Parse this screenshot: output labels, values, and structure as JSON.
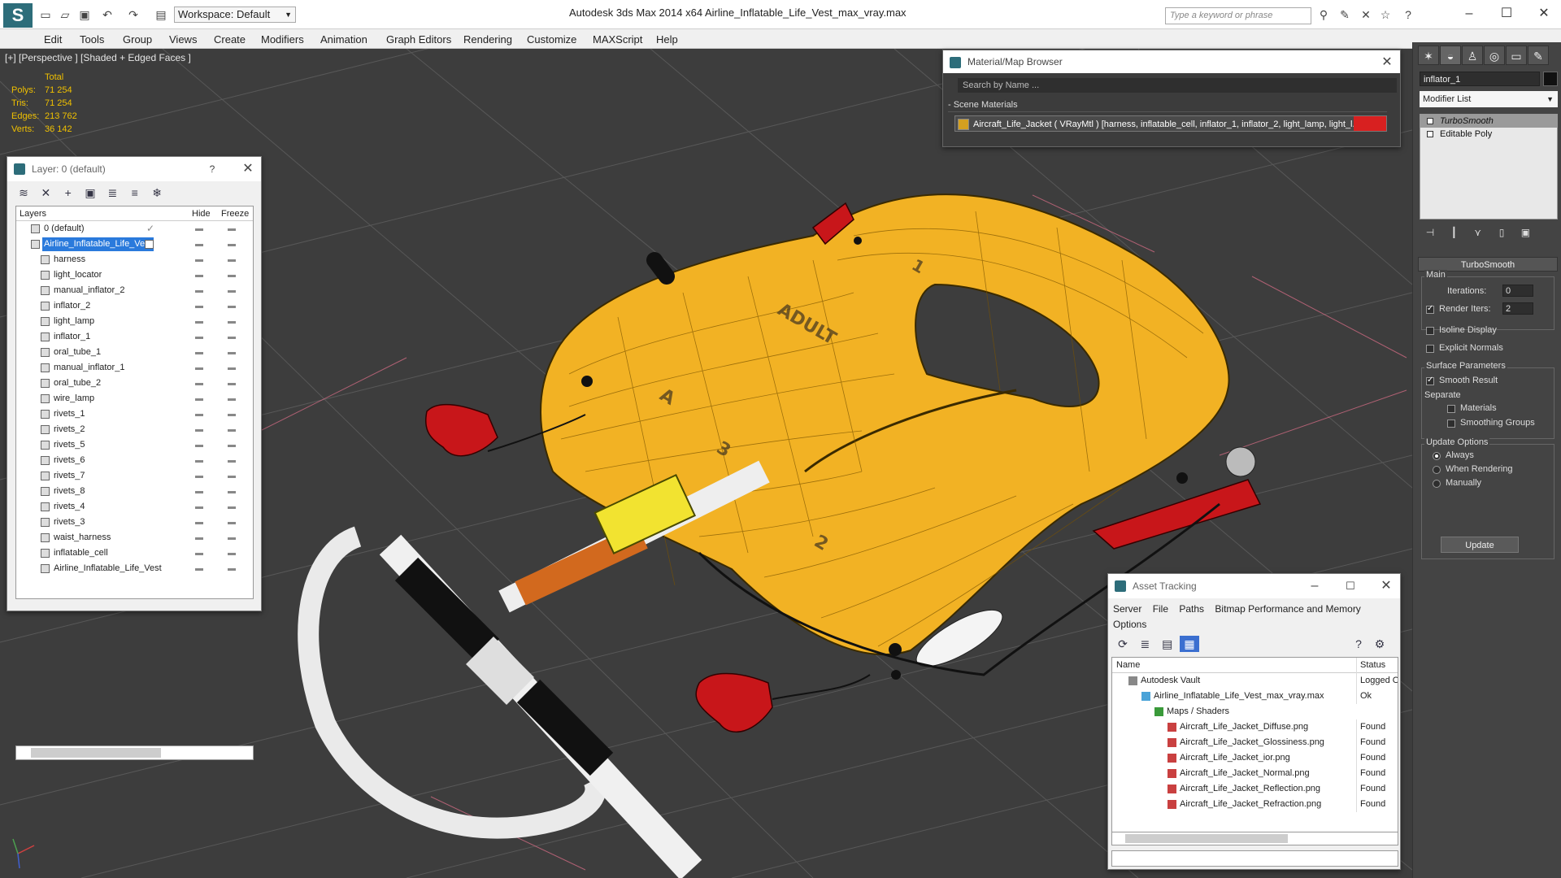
{
  "app": {
    "window_title": "Autodesk 3ds Max  2014 x64      Airline_Inflatable_Life_Vest_max_vray.max",
    "workspace": "Workspace: Default",
    "search_placeholder": "Type a keyword or phrase"
  },
  "menu": [
    "Edit",
    "Tools",
    "Group",
    "Views",
    "Create",
    "Modifiers",
    "Animation",
    "Graph Editors",
    "Rendering",
    "Customize",
    "MAXScript",
    "Help"
  ],
  "viewport": {
    "label": "[+] [Perspective ] [Shaded + Edged Faces ]",
    "stats": {
      "header": "Total",
      "rows": [
        {
          "label": "Polys:",
          "value": "71 254"
        },
        {
          "label": "Tris:",
          "value": "71 254"
        },
        {
          "label": "Edges:",
          "value": "213 762"
        },
        {
          "label": "Verts:",
          "value": "36 142"
        }
      ]
    }
  },
  "layer_dialog": {
    "title": "Layer: 0 (default)",
    "help": "?",
    "columns": {
      "layers": "Layers",
      "hide": "Hide",
      "freeze": "Freeze"
    },
    "rows": [
      {
        "name": "0 (default)",
        "level": 1,
        "type": "layer"
      },
      {
        "name": "Airline_Inflatable_Life_Vest",
        "level": 1,
        "type": "layer",
        "selected": true
      },
      {
        "name": "harness",
        "level": 2,
        "type": "object"
      },
      {
        "name": "light_locator",
        "level": 2,
        "type": "object"
      },
      {
        "name": "manual_inflator_2",
        "level": 2,
        "type": "object"
      },
      {
        "name": "inflator_2",
        "level": 2,
        "type": "object"
      },
      {
        "name": "light_lamp",
        "level": 2,
        "type": "object"
      },
      {
        "name": "inflator_1",
        "level": 2,
        "type": "object"
      },
      {
        "name": "oral_tube_1",
        "level": 2,
        "type": "object"
      },
      {
        "name": "manual_inflator_1",
        "level": 2,
        "type": "object"
      },
      {
        "name": "oral_tube_2",
        "level": 2,
        "type": "object"
      },
      {
        "name": "wire_lamp",
        "level": 2,
        "type": "object"
      },
      {
        "name": "rivets_1",
        "level": 2,
        "type": "object"
      },
      {
        "name": "rivets_2",
        "level": 2,
        "type": "object"
      },
      {
        "name": "rivets_5",
        "level": 2,
        "type": "object"
      },
      {
        "name": "rivets_6",
        "level": 2,
        "type": "object"
      },
      {
        "name": "rivets_7",
        "level": 2,
        "type": "object"
      },
      {
        "name": "rivets_8",
        "level": 2,
        "type": "object"
      },
      {
        "name": "rivets_4",
        "level": 2,
        "type": "object"
      },
      {
        "name": "rivets_3",
        "level": 2,
        "type": "object"
      },
      {
        "name": "waist_harness",
        "level": 2,
        "type": "object"
      },
      {
        "name": "inflatable_cell",
        "level": 2,
        "type": "object"
      },
      {
        "name": "Airline_Inflatable_Life_Vest",
        "level": 2,
        "type": "object"
      }
    ]
  },
  "material_browser": {
    "title": "Material/Map Browser",
    "search_placeholder": "Search by Name ...",
    "section": "- Scene Materials",
    "item": "Aircraft_Life_Jacket  ( VRayMtl )  [harness, inflatable_cell, inflator_1, inflator_2, light_lamp, light_l..."
  },
  "command_panel": {
    "object_name": "inflator_1",
    "modifier_list": "Modifier List",
    "stack": [
      {
        "name": "TurboSmooth",
        "highlight": true
      },
      {
        "name": "Editable Poly",
        "highlight": false
      }
    ],
    "turbosmooth": {
      "title": "TurboSmooth",
      "main": "Main",
      "iterations_label": "Iterations:",
      "iterations_value": "0",
      "render_iters_label": "Render Iters:",
      "render_iters_value": "2",
      "render_iters_checked": true,
      "isoline": "Isoline Display",
      "explicit_normals": "Explicit Normals",
      "surface_params": "Surface Parameters",
      "smooth_result": "Smooth Result",
      "separate": "Separate",
      "materials": "Materials",
      "smoothing_groups": "Smoothing Groups",
      "update_options": "Update Options",
      "always": "Always",
      "when_rendering": "When Rendering",
      "manually": "Manually",
      "update_button": "Update"
    }
  },
  "asset_tracking": {
    "title": "Asset Tracking",
    "menu": [
      "Server",
      "File",
      "Paths",
      "Bitmap Performance and Memory",
      "Options"
    ],
    "columns": {
      "name": "Name",
      "status": "Status"
    },
    "rows": [
      {
        "name": "Autodesk Vault",
        "status": "Logged O",
        "level": 1,
        "icon": "vault"
      },
      {
        "name": "Airline_Inflatable_Life_Vest_max_vray.max",
        "status": "Ok",
        "level": 2,
        "icon": "max"
      },
      {
        "name": "Maps / Shaders",
        "status": "",
        "level": 3,
        "icon": "folder"
      },
      {
        "name": "Aircraft_Life_Jacket_Diffuse.png",
        "status": "Found",
        "level": 4,
        "icon": "png"
      },
      {
        "name": "Aircraft_Life_Jacket_Glossiness.png",
        "status": "Found",
        "level": 4,
        "icon": "png"
      },
      {
        "name": "Aircraft_Life_Jacket_ior.png",
        "status": "Found",
        "level": 4,
        "icon": "png"
      },
      {
        "name": "Aircraft_Life_Jacket_Normal.png",
        "status": "Found",
        "level": 4,
        "icon": "png"
      },
      {
        "name": "Aircraft_Life_Jacket_Reflection.png",
        "status": "Found",
        "level": 4,
        "icon": "png"
      },
      {
        "name": "Aircraft_Life_Jacket_Refraction.png",
        "status": "Found",
        "level": 4,
        "icon": "png"
      }
    ]
  },
  "colors": {
    "vest_yellow": "#f2b224",
    "inflator_red": "#c8161a",
    "selection_blue": "#2a7adc",
    "stats_yellow": "#f0c000"
  }
}
